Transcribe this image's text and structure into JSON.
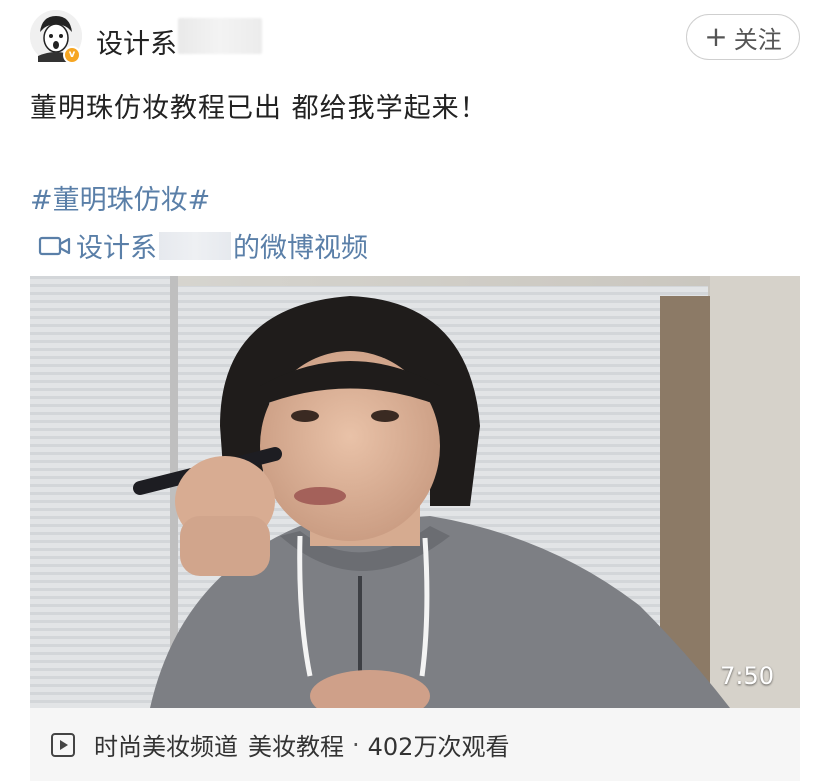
{
  "header": {
    "username": "设计系",
    "follow_label": "关注",
    "follow_symbol": "+",
    "verified_badge": "v",
    "verified_color": "#f6a623"
  },
  "post": {
    "text": "董明珠仿妆教程已出  都给我学起来！",
    "hashtag": "#董明珠仿妆#",
    "video_link_prefix": "设计系",
    "video_link_suffix": "的微博视频",
    "link_color": "#5a7fa8"
  },
  "video": {
    "duration": "7:50"
  },
  "footer": {
    "channel": "时尚美妆频道",
    "category": "美妆教程",
    "separator": "·",
    "views": "402万次观看"
  },
  "icons": {
    "avatar": "avatar-illustration",
    "video_link": "video-camera-icon",
    "footer": "play-square-icon"
  }
}
